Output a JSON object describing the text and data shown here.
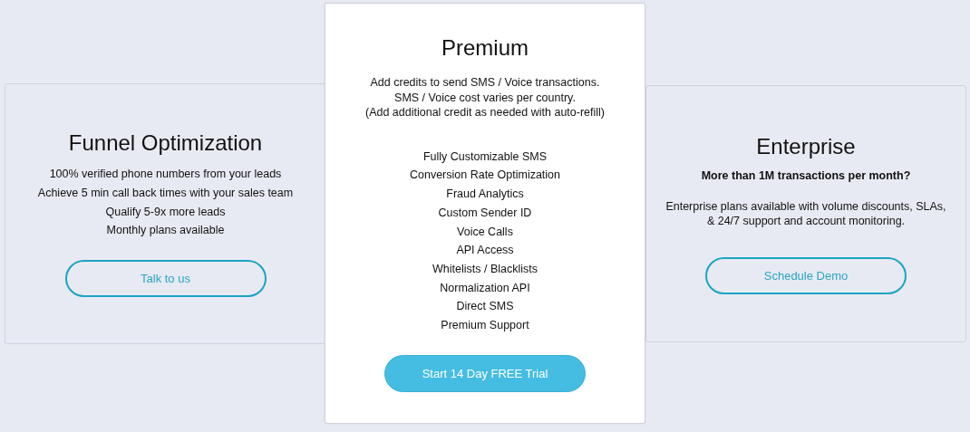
{
  "plans": [
    {
      "title": "Funnel Optimization",
      "highlighted": false,
      "features": [
        "100% verified phone numbers from your leads",
        "Achieve 5 min call back times with your sales team",
        "Qualify 5-9x more leads",
        "Monthly plans available"
      ],
      "button": {
        "label": "Talk to us",
        "kind": "outline"
      }
    },
    {
      "title": "Premium",
      "highlighted": true,
      "description": [
        "Add credits to send SMS / Voice transactions.",
        "SMS / Voice cost varies per country.",
        "(Add additional credit as needed with auto-refill)"
      ],
      "features": [
        "Fully Customizable SMS",
        "Conversion Rate Optimization",
        "Fraud Analytics",
        "Custom Sender ID",
        "Voice Calls",
        "API Access",
        "Whitelists / Blacklists",
        "Normalization API",
        "Direct SMS",
        "Premium Support"
      ],
      "button": {
        "label": "Start 14 Day FREE Trial",
        "kind": "filled"
      }
    },
    {
      "title": "Enterprise",
      "highlighted": false,
      "subtitle": "More than 1M transactions per month?",
      "paragraph": "Enterprise plans available with volume discounts, SLAs, & 24/7 support and account monitoring.",
      "button": {
        "label": "Schedule Demo",
        "kind": "outline"
      }
    }
  ]
}
